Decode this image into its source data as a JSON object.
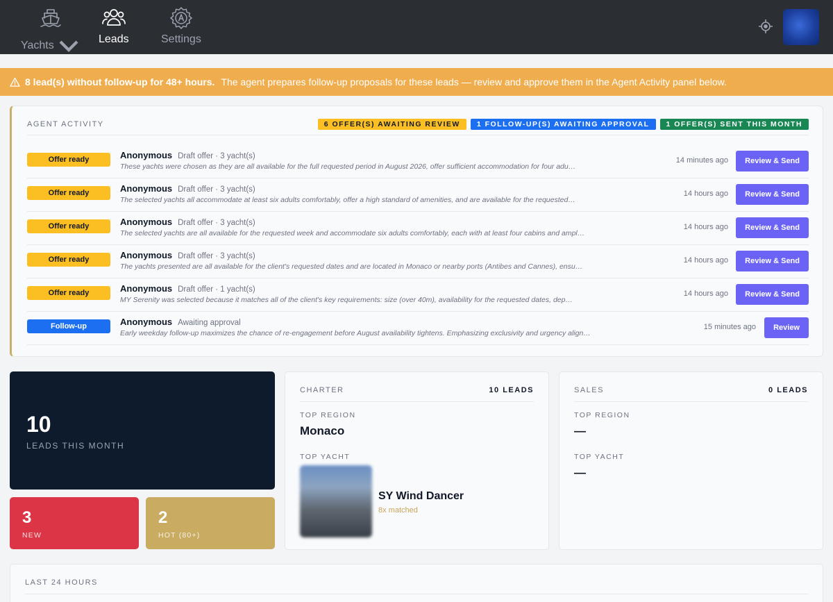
{
  "nav": {
    "items": [
      {
        "label": "Yachts",
        "icon": "ship-icon",
        "active": false
      },
      {
        "label": "Leads",
        "icon": "users-icon",
        "active": true
      },
      {
        "label": "Settings",
        "icon": "gear-icon",
        "active": false
      }
    ],
    "location_icon": "crosshair-icon",
    "avatar": "user-avatar"
  },
  "alert": {
    "icon": "warning-icon",
    "bold": "8 lead(s) without follow-up for 48+ hours.",
    "text": "The agent prepares follow-up proposals for these leads — review and approve them in the Agent Activity panel below."
  },
  "agent_activity": {
    "title": "AGENT ACTIVITY",
    "pills": {
      "awaiting_review": "6 OFFER(S) AWAITING REVIEW",
      "awaiting_approval": "1 FOLLOW-UP(S) AWAITING APPROVAL",
      "sent_month": "1 OFFER(S) SENT THIS MONTH"
    },
    "rows": [
      {
        "tag": "Offer ready",
        "name": "Anonymous",
        "meta": "Draft offer · 3 yacht(s)",
        "desc": "These yachts were chosen as they are all available for the full requested period in August 2026, offer sufficient accommodation for four adu…",
        "time": "14 minutes ago",
        "button": "Review & Send"
      },
      {
        "tag": "Offer ready",
        "name": "Anonymous",
        "meta": "Draft offer · 3 yacht(s)",
        "desc": "The selected yachts all accommodate at least six adults comfortably, offer a high standard of amenities, and are available for the requested…",
        "time": "14 hours ago",
        "button": "Review & Send"
      },
      {
        "tag": "Offer ready",
        "name": "Anonymous",
        "meta": "Draft offer · 3 yacht(s)",
        "desc": "The selected yachts are all available for the requested week and accommodate six adults comfortably, each with at least four cabins and ampl…",
        "time": "14 hours ago",
        "button": "Review & Send"
      },
      {
        "tag": "Offer ready",
        "name": "Anonymous",
        "meta": "Draft offer · 3 yacht(s)",
        "desc": "The yachts presented are all available for the client's requested dates and are located in Monaco or nearby ports (Antibes and Cannes), ensu…",
        "time": "14 hours ago",
        "button": "Review & Send"
      },
      {
        "tag": "Offer ready",
        "name": "Anonymous",
        "meta": "Draft offer · 1 yacht(s)",
        "desc": "MY Serenity was selected because it matches all of the client's key requirements: size (over 40m), availability for the requested dates, dep…",
        "time": "14 hours ago",
        "button": "Review & Send"
      },
      {
        "tag": "Follow-up",
        "name": "Anonymous",
        "meta": "Awaiting approval",
        "desc": "Early weekday follow-up maximizes the chance of re-engagement before August availability tightens. Emphasizing exclusivity and urgency align…",
        "time": "15 minutes ago",
        "button": "Review"
      }
    ]
  },
  "stats": {
    "leads_month": {
      "value": "10",
      "label": "LEADS THIS MONTH"
    },
    "new": {
      "value": "3",
      "label": "NEW"
    },
    "hot": {
      "value": "2",
      "label": "HOT (80+)"
    }
  },
  "charter": {
    "title": "CHARTER",
    "count": "10 LEADS",
    "top_region_label": "TOP REGION",
    "top_region": "Monaco",
    "top_yacht_label": "TOP YACHT",
    "top_yacht": "SY Wind Dancer",
    "top_yacht_sub": "8x matched"
  },
  "sales": {
    "title": "SALES",
    "count": "0 LEADS",
    "top_region_label": "TOP REGION",
    "top_region": "—",
    "top_yacht_label": "TOP YACHT",
    "top_yacht": "—"
  },
  "last24": {
    "title": "LAST 24 HOURS"
  },
  "colors": {
    "nav_bg": "#2b2e33",
    "alert": "#f0ad4e",
    "offer": "#fbbf24",
    "follow": "#1d6ff2",
    "sent": "#198754",
    "button": "#6b63f5",
    "dark_card": "#0d1b2d",
    "new": "#dc3545",
    "hot": "#c9ab62"
  }
}
